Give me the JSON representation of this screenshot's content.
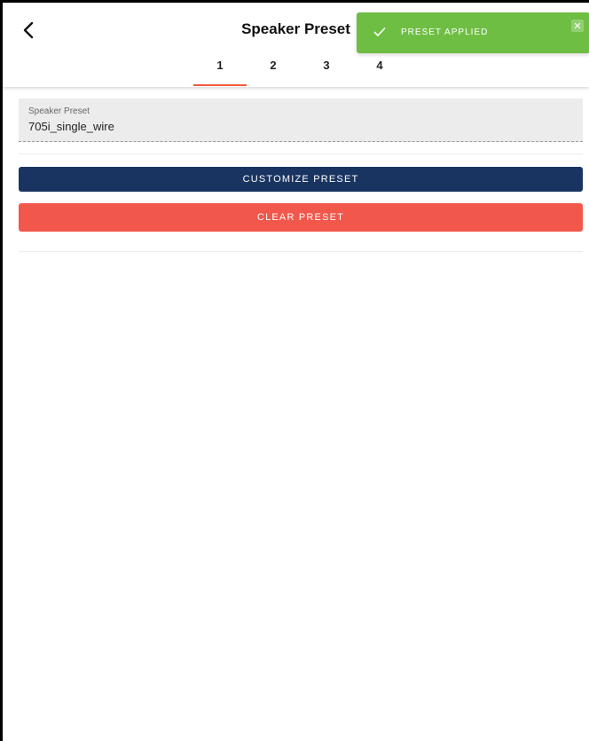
{
  "header": {
    "title": "Speaker Preset",
    "back_icon": "chevron-left-icon"
  },
  "tabs": [
    {
      "label": "1",
      "active": true
    },
    {
      "label": "2",
      "active": false
    },
    {
      "label": "3",
      "active": false
    },
    {
      "label": "4",
      "active": false
    }
  ],
  "toast": {
    "message": "PRESET APPLIED",
    "icon": "check-icon",
    "close_icon": "close-icon",
    "color": "#6fbe44"
  },
  "preset_field": {
    "label": "Speaker Preset",
    "value": "705i_single_wire"
  },
  "actions": {
    "customize_label": "CUSTOMIZE PRESET",
    "clear_label": "CLEAR PRESET"
  },
  "colors": {
    "accent": "#f05a3a",
    "primary": "#1a3462",
    "danger": "#f2574c",
    "success": "#6fbe44"
  }
}
